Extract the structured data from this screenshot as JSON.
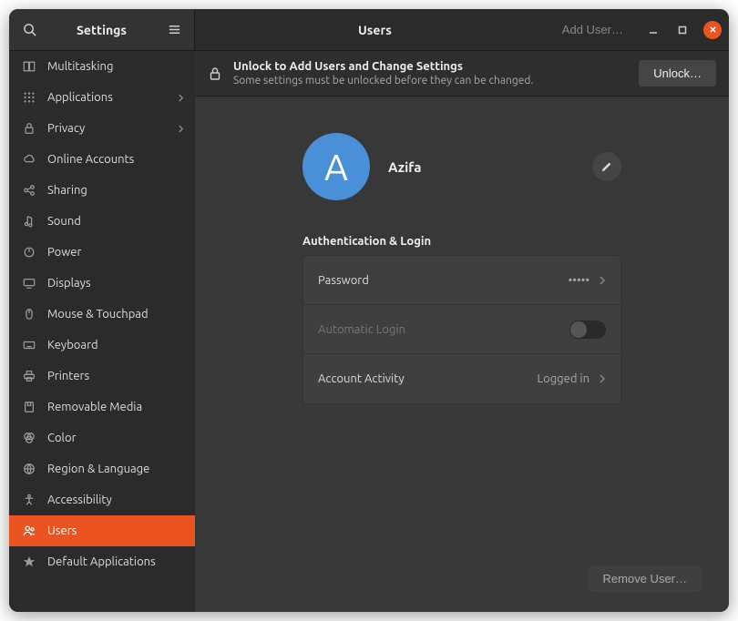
{
  "header": {
    "sidebar_title": "Settings",
    "page_title": "Users",
    "add_user_label": "Add User…"
  },
  "sidebar": {
    "items": [
      {
        "icon": "multitasking",
        "label": "Multitasking",
        "chevron": false
      },
      {
        "icon": "applications",
        "label": "Applications",
        "chevron": true
      },
      {
        "icon": "privacy",
        "label": "Privacy",
        "chevron": true
      },
      {
        "icon": "online-accounts",
        "label": "Online Accounts",
        "chevron": false
      },
      {
        "icon": "sharing",
        "label": "Sharing",
        "chevron": false
      },
      {
        "icon": "sound",
        "label": "Sound",
        "chevron": false
      },
      {
        "icon": "power",
        "label": "Power",
        "chevron": false
      },
      {
        "icon": "displays",
        "label": "Displays",
        "chevron": false
      },
      {
        "icon": "mouse",
        "label": "Mouse & Touchpad",
        "chevron": false
      },
      {
        "icon": "keyboard",
        "label": "Keyboard",
        "chevron": false
      },
      {
        "icon": "printers",
        "label": "Printers",
        "chevron": false
      },
      {
        "icon": "removable-media",
        "label": "Removable Media",
        "chevron": false
      },
      {
        "icon": "color",
        "label": "Color",
        "chevron": false
      },
      {
        "icon": "region",
        "label": "Region & Language",
        "chevron": false
      },
      {
        "icon": "accessibility",
        "label": "Accessibility",
        "chevron": false
      },
      {
        "icon": "users",
        "label": "Users",
        "chevron": false,
        "active": true
      },
      {
        "icon": "default-apps",
        "label": "Default Applications",
        "chevron": false
      }
    ]
  },
  "infobar": {
    "title": "Unlock to Add Users and Change Settings",
    "subtitle": "Some settings must be unlocked before they can be changed.",
    "button": "Unlock…"
  },
  "user": {
    "initial": "A",
    "name": "Azifa"
  },
  "auth_section": {
    "title": "Authentication & Login",
    "rows": {
      "password": {
        "label": "Password",
        "value": "•••••"
      },
      "auto_login": {
        "label": "Automatic Login"
      },
      "activity": {
        "label": "Account Activity",
        "value": "Logged in"
      }
    }
  },
  "footer": {
    "remove_user": "Remove User…"
  }
}
